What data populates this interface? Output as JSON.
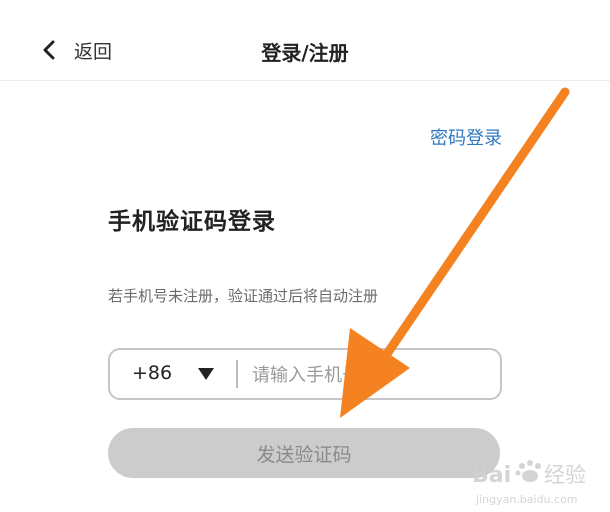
{
  "header": {
    "back_label": "返回",
    "title": "登录/注册"
  },
  "login": {
    "password_login": "密码登录",
    "heading": "手机验证码登录",
    "tip": "若手机号未注册，验证通过后将自动注册",
    "country_code": "+86",
    "phone_placeholder": "请输入手机号",
    "send_code_label": "发送验证码"
  },
  "icons": {
    "back": "chevron-left-icon",
    "dropdown": "caret-down-icon"
  },
  "colors": {
    "link": "#2f78bf",
    "button_disabled": "#cccccc",
    "annotation_arrow": "#f58220"
  },
  "watermark": {
    "brand": "Bai度经验",
    "url": "jingyan.baidu.com"
  }
}
